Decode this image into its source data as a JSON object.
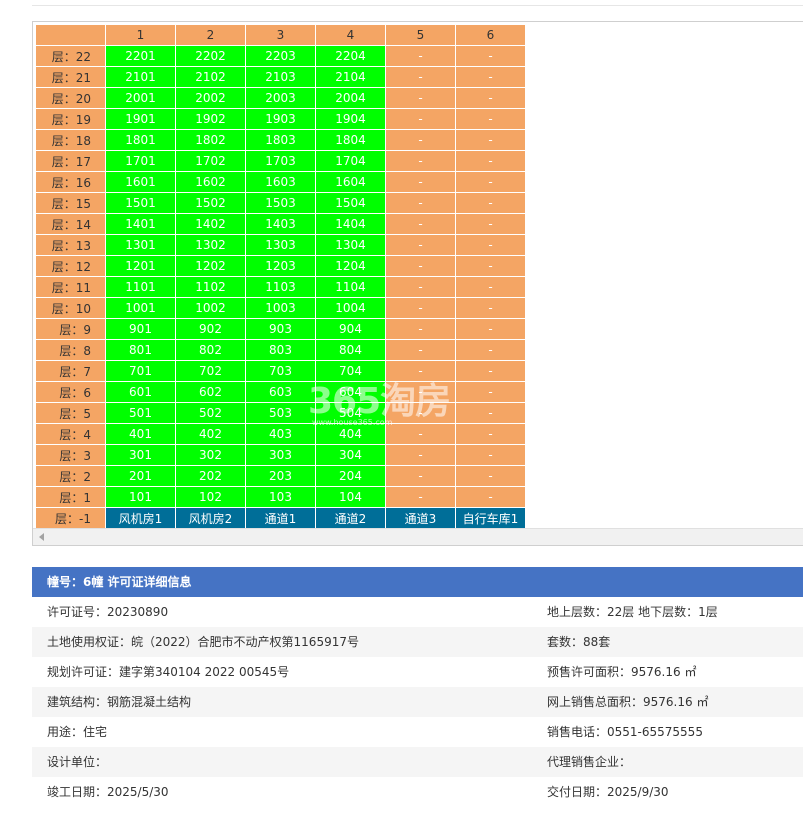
{
  "grid": {
    "columns": [
      "",
      "1",
      "2",
      "3",
      "4",
      "5",
      "6"
    ],
    "rows": [
      {
        "floor": "层：22",
        "units": [
          "2201",
          "2202",
          "2203",
          "2204",
          "-",
          "-"
        ]
      },
      {
        "floor": "层：21",
        "units": [
          "2101",
          "2102",
          "2103",
          "2104",
          "-",
          "-"
        ]
      },
      {
        "floor": "层：20",
        "units": [
          "2001",
          "2002",
          "2003",
          "2004",
          "-",
          "-"
        ]
      },
      {
        "floor": "层：19",
        "units": [
          "1901",
          "1902",
          "1903",
          "1904",
          "-",
          "-"
        ]
      },
      {
        "floor": "层：18",
        "units": [
          "1801",
          "1802",
          "1803",
          "1804",
          "-",
          "-"
        ]
      },
      {
        "floor": "层：17",
        "units": [
          "1701",
          "1702",
          "1703",
          "1704",
          "-",
          "-"
        ]
      },
      {
        "floor": "层：16",
        "units": [
          "1601",
          "1602",
          "1603",
          "1604",
          "-",
          "-"
        ]
      },
      {
        "floor": "层：15",
        "units": [
          "1501",
          "1502",
          "1503",
          "1504",
          "-",
          "-"
        ]
      },
      {
        "floor": "层：14",
        "units": [
          "1401",
          "1402",
          "1403",
          "1404",
          "-",
          "-"
        ]
      },
      {
        "floor": "层：13",
        "units": [
          "1301",
          "1302",
          "1303",
          "1304",
          "-",
          "-"
        ]
      },
      {
        "floor": "层：12",
        "units": [
          "1201",
          "1202",
          "1203",
          "1204",
          "-",
          "-"
        ]
      },
      {
        "floor": "层：11",
        "units": [
          "1101",
          "1102",
          "1103",
          "1104",
          "-",
          "-"
        ]
      },
      {
        "floor": "层：10",
        "units": [
          "1001",
          "1002",
          "1003",
          "1004",
          "-",
          "-"
        ]
      },
      {
        "floor": "层：9",
        "units": [
          "901",
          "902",
          "903",
          "904",
          "-",
          "-"
        ]
      },
      {
        "floor": "层：8",
        "units": [
          "801",
          "802",
          "803",
          "804",
          "-",
          "-"
        ]
      },
      {
        "floor": "层：7",
        "units": [
          "701",
          "702",
          "703",
          "704",
          "-",
          "-"
        ]
      },
      {
        "floor": "层：6",
        "units": [
          "601",
          "602",
          "603",
          "604",
          "-",
          "-"
        ]
      },
      {
        "floor": "层：5",
        "units": [
          "501",
          "502",
          "503",
          "504",
          "-",
          "-"
        ]
      },
      {
        "floor": "层：4",
        "units": [
          "401",
          "402",
          "403",
          "404",
          "-",
          "-"
        ]
      },
      {
        "floor": "层：3",
        "units": [
          "301",
          "302",
          "303",
          "304",
          "-",
          "-"
        ]
      },
      {
        "floor": "层：2",
        "units": [
          "201",
          "202",
          "203",
          "204",
          "-",
          "-"
        ]
      },
      {
        "floor": "层：1",
        "units": [
          "101",
          "102",
          "103",
          "104",
          "-",
          "-"
        ]
      }
    ],
    "basement": {
      "floor": "层：-1",
      "units": [
        "风机房1",
        "风机房2",
        "通道1",
        "通道2",
        "通道3",
        "自行车库1"
      ]
    },
    "colors": {
      "available": "#00ff00",
      "none": "#f4a564",
      "basement": "#006e98",
      "header": "#f4a564"
    }
  },
  "watermark": {
    "main": "365淘房",
    "sub": "www.house365.com"
  },
  "info": {
    "header": "幢号：6幢 许可证详细信息",
    "header_color": "#4573c4",
    "rows": [
      {
        "left": "许可证号：20230890",
        "right": "地上层数：22层  地下层数：1层"
      },
      {
        "left": "土地使用权证：皖（2022）合肥市不动产权第1165917号",
        "right": "套数：88套"
      },
      {
        "left": "规划许可证：建字第340104 2022 00545号",
        "right": "预售许可面积：9576.16 ㎡"
      },
      {
        "left": "建筑结构：钢筋混凝土结构",
        "right": "网上销售总面积：9576.16 ㎡"
      },
      {
        "left": "用途：住宅",
        "right": "销售电话：0551-65575555"
      },
      {
        "left": "设计单位：",
        "right": "代理销售企业："
      },
      {
        "left": "竣工日期：2025/5/30",
        "right": "交付日期：2025/9/30"
      }
    ]
  }
}
